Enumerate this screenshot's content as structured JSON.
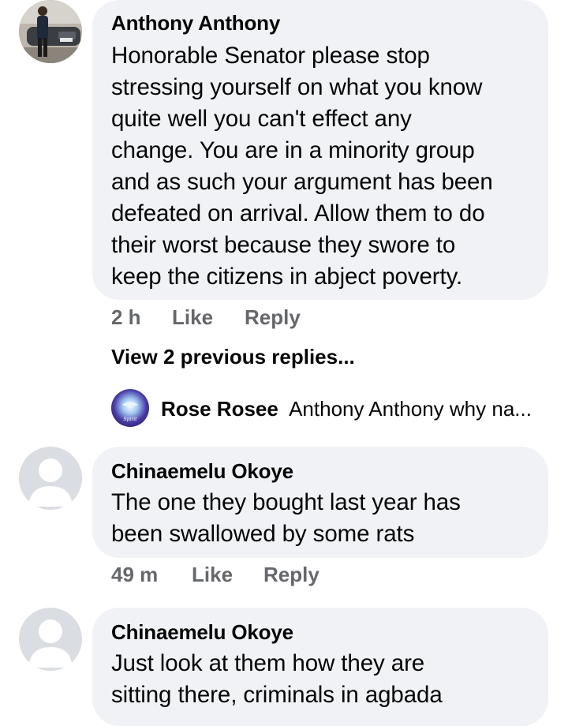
{
  "comments": [
    {
      "author": "Anthony Anthony",
      "text_lines": [
        "Honorable Senator please stop",
        "stressing yourself on what you know",
        "quite well you can't effect any",
        "change. You are in a minority group",
        "and as such your argument has been",
        "defeated on arrival. Allow them to do",
        "their worst because they swore to",
        "keep the citizens in abject poverty."
      ],
      "time": "2 h",
      "like": "Like",
      "reply": "Reply"
    },
    {
      "author": "Chinaemelu Okoye",
      "text_lines": [
        "The one they bought last year  has",
        "been swallowed by some  rats"
      ],
      "time": "49 m",
      "like": "Like",
      "reply": "Reply"
    },
    {
      "author": "Chinaemelu Okoye",
      "text_lines": [
        "Just look at them how they are",
        "sitting  there, criminals in agbada"
      ]
    }
  ],
  "view_previous": "View 2 previous replies...",
  "reply_preview": {
    "author": "Rose Rosee",
    "text": "Anthony Anthony why na..."
  },
  "colors": {
    "bubble": "#f0f2f5",
    "meta": "#65676b",
    "text": "#050505"
  }
}
